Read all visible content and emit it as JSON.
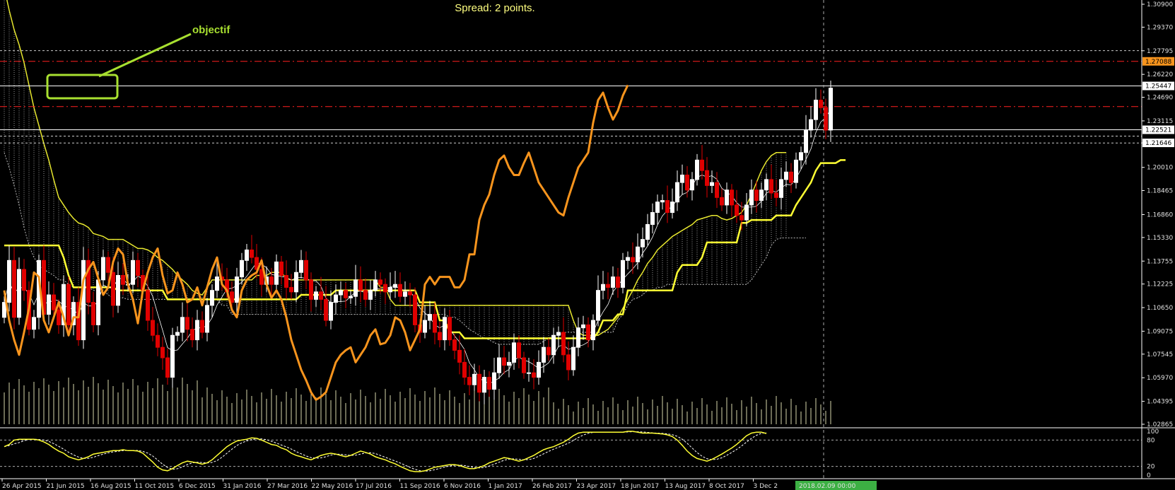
{
  "spread_text": "Spread: 2 points.",
  "annotation_text": "objectif",
  "crosshair_date": "2018.02.09 00:00",
  "colors": {
    "background": "#000000",
    "bull_candle": "#ffffff",
    "bear_candle": "#e00000",
    "kijun": "#ffff33",
    "tenkan": "#ffffff",
    "chikou": "#f7941d",
    "kumo": "#cccccc",
    "volume": "#ffffcc",
    "annotation": "#a8e030",
    "level_line": "#ff2020",
    "price_tag_orange": "#f7941d",
    "oscillator": "#ffff33"
  },
  "chart_data": [
    {
      "type": "candlestick",
      "symbol_hint": "EURUSD weekly with Ichimoku",
      "title": "",
      "y_ticks": [
        "1.30900",
        "1.29370",
        "1.27795",
        "1.26220",
        "1.24690",
        "1.23115",
        "1.21646",
        "1.20010",
        "1.18465",
        "1.16860",
        "1.15330",
        "1.13755",
        "1.12225",
        "1.10650",
        "1.09075",
        "1.07545",
        "1.05970",
        "1.04395",
        "1.02865"
      ],
      "price_tags": [
        {
          "value": "1.27088",
          "style": "orange"
        },
        {
          "value": "1.25447",
          "style": "white"
        },
        {
          "value": "1.22521",
          "style": "white"
        },
        {
          "value": "1.21646",
          "style": "white"
        }
      ],
      "x_labels": [
        "26 Apr 2015",
        "21 Jun 2015",
        "16 Aug 2015",
        "11 Oct 2015",
        "6 Dec 2015",
        "31 Jan 2016",
        "27 Mar 2016",
        "22 May 2016",
        "17 Jul 2016",
        "11 Sep 2016",
        "6 Nov 2016",
        "1 Jan 2017",
        "26 Feb 2017",
        "23 Apr 2017",
        "18 Jun 2017",
        "13 Aug 2017",
        "8 Oct 2017",
        "3 Dec 2"
      ],
      "horizontal_levels": [
        {
          "value": 1.2709,
          "style": "dash-red"
        },
        {
          "value": 1.2407,
          "style": "dash-red"
        },
        {
          "value": 1.2545,
          "style": "solid-white"
        },
        {
          "value": 1.2252,
          "style": "solid-white"
        },
        {
          "value": 1.2164,
          "style": "dot-white"
        },
        {
          "value": 1.278,
          "style": "dot-white"
        },
        {
          "value": 1.221,
          "style": "dot-white"
        }
      ],
      "closes": [
        1.11,
        1.138,
        1.1,
        1.132,
        1.118,
        1.092,
        1.1,
        1.138,
        1.102,
        1.115,
        1.105,
        1.095,
        1.122,
        1.095,
        1.11,
        1.085,
        1.138,
        1.11,
        1.095,
        1.125,
        1.14,
        1.13,
        1.108,
        1.128,
        1.122,
        1.122,
        1.138,
        1.128,
        1.118,
        1.098,
        1.088,
        1.08,
        1.073,
        1.06,
        1.088,
        1.09,
        1.1,
        1.092,
        1.085,
        1.098,
        1.09,
        1.108,
        1.118,
        1.127,
        1.125,
        1.117,
        1.11,
        1.127,
        1.138,
        1.145,
        1.14,
        1.132,
        1.122,
        1.127,
        1.122,
        1.137,
        1.128,
        1.12,
        1.117,
        1.13,
        1.138,
        1.125,
        1.112,
        1.117,
        1.112,
        1.098,
        1.11,
        1.115,
        1.118,
        1.113,
        1.114,
        1.125,
        1.118,
        1.112,
        1.118,
        1.125,
        1.122,
        1.117,
        1.12,
        1.122,
        1.114,
        1.117,
        1.115,
        1.095,
        1.09,
        1.098,
        1.102,
        1.09,
        1.085,
        1.1,
        1.085,
        1.078,
        1.07,
        1.06,
        1.055,
        1.062,
        1.05,
        1.06,
        1.052,
        1.063,
        1.073,
        1.068,
        1.07,
        1.083,
        1.073,
        1.063,
        1.063,
        1.06,
        1.07,
        1.08,
        1.075,
        1.088,
        1.09,
        1.075,
        1.065,
        1.08,
        1.093,
        1.095,
        1.085,
        1.098,
        1.118,
        1.122,
        1.12,
        1.127,
        1.12,
        1.138,
        1.14,
        1.137,
        1.147,
        1.152,
        1.162,
        1.17,
        1.177,
        1.178,
        1.17,
        1.177,
        1.19,
        1.195,
        1.185,
        1.192,
        1.205,
        1.198,
        1.188,
        1.19,
        1.18,
        1.175,
        1.185,
        1.175,
        1.168,
        1.165,
        1.175,
        1.185,
        1.178,
        1.185,
        1.192,
        1.183,
        1.18,
        1.192,
        1.197,
        1.19,
        1.205,
        1.21,
        1.225,
        1.232,
        1.245,
        1.24,
        1.225,
        1.253
      ],
      "series": [
        {
          "name": "kijun",
          "values": [
            1.148,
            1.148,
            1.148,
            1.148,
            1.148,
            1.148,
            1.148,
            1.148,
            1.148,
            1.148,
            1.148,
            1.148,
            1.14,
            1.128,
            1.12,
            1.12,
            1.12,
            1.12,
            1.12,
            1.12,
            1.12,
            1.12,
            1.12,
            1.118,
            1.118,
            1.118,
            1.118,
            1.118,
            1.118,
            1.118,
            1.118,
            1.118,
            1.118,
            1.112,
            1.112,
            1.112,
            1.112,
            1.112,
            1.112,
            1.112,
            1.112,
            1.112,
            1.112,
            1.112,
            1.112,
            1.112,
            1.112,
            1.112,
            1.112,
            1.112,
            1.112,
            1.112,
            1.112,
            1.112,
            1.112,
            1.112,
            1.112,
            1.112,
            1.112,
            1.112,
            1.115,
            1.115,
            1.115,
            1.115,
            1.115,
            1.115,
            1.115,
            1.118,
            1.118,
            1.118,
            1.118,
            1.118,
            1.118,
            1.118,
            1.118,
            1.118,
            1.118,
            1.118,
            1.118,
            1.118,
            1.118,
            1.118,
            1.118,
            1.118,
            1.11,
            1.11,
            1.11,
            1.11,
            1.098,
            1.098,
            1.09,
            1.09,
            1.09,
            1.086,
            1.086,
            1.086,
            1.086,
            1.086,
            1.086,
            1.086,
            1.086,
            1.086,
            1.086,
            1.086,
            1.086,
            1.086,
            1.086,
            1.086,
            1.086,
            1.086,
            1.086,
            1.086,
            1.086,
            1.086,
            1.086,
            1.086,
            1.086,
            1.086,
            1.086,
            1.086,
            1.09,
            1.098,
            1.098,
            1.098,
            1.102,
            1.102,
            1.118,
            1.118,
            1.118,
            1.118,
            1.118,
            1.118,
            1.118,
            1.118,
            1.118,
            1.118,
            1.13,
            1.135,
            1.135,
            1.135,
            1.135,
            1.14,
            1.15,
            1.15,
            1.15,
            1.15,
            1.15,
            1.15,
            1.15,
            1.163,
            1.163,
            1.165,
            1.165,
            1.165,
            1.165,
            1.165,
            1.168,
            1.168,
            1.168,
            1.168,
            1.175,
            1.18,
            1.185,
            1.19,
            1.198,
            1.203,
            1.203,
            1.203,
            1.203,
            1.205,
            1.205
          ]
        },
        {
          "name": "chikou",
          "values": [
            1.118,
            1.098,
            1.085,
            1.075,
            1.09,
            1.106,
            1.13,
            1.127,
            1.098,
            1.09,
            1.1,
            1.11,
            1.1,
            1.088,
            1.1,
            1.1,
            1.125,
            1.132,
            1.137,
            1.126,
            1.115,
            1.12,
            1.137,
            1.146,
            1.142,
            1.122,
            1.112,
            1.096,
            1.118,
            1.13,
            1.14,
            1.146,
            1.128,
            1.116,
            1.118,
            1.13,
            1.122,
            1.11,
            1.112,
            1.12,
            1.108,
            1.12,
            1.132,
            1.14,
            1.122,
            1.118,
            1.105,
            1.1,
            1.118,
            1.125,
            1.128,
            1.13,
            1.138,
            1.122,
            1.113,
            1.118,
            1.112,
            1.1,
            1.085,
            1.075,
            1.065,
            1.058,
            1.05,
            1.045,
            1.047,
            1.05,
            1.06,
            1.07,
            1.075,
            1.078,
            1.08,
            1.07,
            1.075,
            1.08,
            1.088,
            1.092,
            1.082,
            1.083,
            1.088,
            1.1,
            1.098,
            1.09,
            1.078,
            1.085,
            1.092,
            1.122,
            1.127,
            1.122,
            1.127,
            1.127,
            1.127,
            1.12,
            1.12,
            1.125,
            1.142,
            1.142,
            1.165,
            1.175,
            1.182,
            1.195,
            1.205,
            1.208,
            1.2,
            1.195,
            1.195,
            1.203,
            1.21,
            1.2,
            1.19,
            1.185,
            1.18,
            1.175,
            1.17,
            1.168,
            1.18,
            1.19,
            1.2,
            1.205,
            1.21,
            1.23,
            1.245,
            1.25,
            1.24,
            1.232,
            1.238,
            1.248,
            1.255
          ]
        },
        {
          "name": "kumo_upper",
          "values": [
            1.32,
            1.305,
            1.292,
            1.282,
            1.27,
            1.255,
            1.24,
            1.228,
            1.216,
            1.205,
            1.192,
            1.18,
            1.175,
            1.17,
            1.166,
            1.163,
            1.162,
            1.16,
            1.156,
            1.155,
            1.154,
            1.152,
            1.152,
            1.152,
            1.152,
            1.15,
            1.148,
            1.146,
            1.146,
            1.145,
            1.143,
            1.14,
            1.138,
            1.135,
            1.132,
            1.128,
            1.125,
            1.122,
            1.118,
            1.116,
            1.115,
            1.12,
            1.125,
            1.125,
            1.125,
            1.125,
            1.125,
            1.125,
            1.125,
            1.125,
            1.125,
            1.128,
            1.128,
            1.128,
            1.13,
            1.13,
            1.13,
            1.126,
            1.125,
            1.125,
            1.125,
            1.125,
            1.125,
            1.125,
            1.125,
            1.125,
            1.125,
            1.125,
            1.125,
            1.125,
            1.125,
            1.125,
            1.125,
            1.125,
            1.125,
            1.125,
            1.12,
            1.12,
            1.112,
            1.108,
            1.108,
            1.108,
            1.108,
            1.108,
            1.108,
            1.108,
            1.108,
            1.108,
            1.108,
            1.108,
            1.108,
            1.108,
            1.108,
            1.108,
            1.108,
            1.108,
            1.108,
            1.108,
            1.108,
            1.108,
            1.108,
            1.108,
            1.108,
            1.108,
            1.108,
            1.108,
            1.108,
            1.108,
            1.108,
            1.108,
            1.108,
            1.108,
            1.108,
            1.108,
            1.108,
            1.098,
            1.09,
            1.088,
            1.088,
            1.088,
            1.088,
            1.09,
            1.092,
            1.096,
            1.1,
            1.106,
            1.112,
            1.118,
            1.125,
            1.13,
            1.136,
            1.14,
            1.145,
            1.148,
            1.151,
            1.154,
            1.156,
            1.158,
            1.16,
            1.162,
            1.165,
            1.166,
            1.167,
            1.168,
            1.168,
            1.166,
            1.165,
            1.166,
            1.168,
            1.17,
            1.175,
            1.182,
            1.19,
            1.198,
            1.204,
            1.208,
            1.21,
            1.21,
            1.21
          ]
        },
        {
          "name": "kumo_lower",
          "values": [
            1.21,
            1.2,
            1.188,
            1.175,
            1.16,
            1.148,
            1.14,
            1.135,
            1.132,
            1.13,
            1.128,
            1.125,
            1.125,
            1.122,
            1.12,
            1.12,
            1.12,
            1.12,
            1.118,
            1.118,
            1.118,
            1.115,
            1.113,
            1.113,
            1.113,
            1.112,
            1.112,
            1.112,
            1.112,
            1.112,
            1.112,
            1.112,
            1.112,
            1.112,
            1.112,
            1.112,
            1.112,
            1.112,
            1.112,
            1.112,
            1.112,
            1.112,
            1.112,
            1.112,
            1.108,
            1.108,
            1.102,
            1.102,
            1.102,
            1.102,
            1.102,
            1.102,
            1.102,
            1.102,
            1.102,
            1.102,
            1.102,
            1.102,
            1.102,
            1.102,
            1.102,
            1.102,
            1.102,
            1.102,
            1.102,
            1.102,
            1.102,
            1.102,
            1.102,
            1.102,
            1.102,
            1.102,
            1.102,
            1.102,
            1.102,
            1.102,
            1.102,
            1.102,
            1.102,
            1.102,
            1.102,
            1.102,
            1.102,
            1.102,
            1.102,
            1.102,
            1.102,
            1.102,
            1.102,
            1.102,
            1.1,
            1.1,
            1.098,
            1.095,
            1.092,
            1.09,
            1.088,
            1.086,
            1.085,
            1.083,
            1.082,
            1.082,
            1.082,
            1.082,
            1.082,
            1.082,
            1.082,
            1.082,
            1.082,
            1.084,
            1.086,
            1.088,
            1.088,
            1.09,
            1.09,
            1.09,
            1.09,
            1.09,
            1.09,
            1.09,
            1.09,
            1.09,
            1.09,
            1.09,
            1.098,
            1.102,
            1.108,
            1.112,
            1.113,
            1.115,
            1.118,
            1.118,
            1.12,
            1.12,
            1.122,
            1.122,
            1.122,
            1.122,
            1.122,
            1.122,
            1.122,
            1.122,
            1.122,
            1.122,
            1.122,
            1.122,
            1.122,
            1.122,
            1.122,
            1.122,
            1.122,
            1.125,
            1.13,
            1.135,
            1.14,
            1.148,
            1.152,
            1.153,
            1.153,
            1.153,
            1.153,
            1.153,
            1.153
          ]
        }
      ]
    },
    {
      "type": "line",
      "title": "",
      "y_ticks": [
        "100",
        "80",
        "20",
        "0"
      ],
      "levels": [
        80,
        20
      ],
      "series": [
        {
          "name": "main",
          "values": [
            65,
            70,
            80,
            82,
            82,
            82,
            82,
            80,
            76,
            70,
            62,
            55,
            50,
            42,
            38,
            35,
            38,
            42,
            48,
            50,
            52,
            54,
            56,
            56,
            58,
            56,
            56,
            55,
            50,
            40,
            30,
            18,
            12,
            10,
            15,
            22,
            28,
            32,
            30,
            28,
            25,
            28,
            35,
            45,
            55,
            65,
            72,
            78,
            80,
            82,
            85,
            84,
            80,
            75,
            70,
            68,
            62,
            58,
            50,
            45,
            42,
            38,
            35,
            40,
            45,
            48,
            50,
            48,
            45,
            42,
            45,
            50,
            55,
            52,
            48,
            42,
            38,
            35,
            30,
            26,
            20,
            15,
            10,
            8,
            8,
            10,
            14,
            18,
            20,
            22,
            24,
            24,
            22,
            18,
            15,
            15,
            18,
            22,
            28,
            32,
            36,
            40,
            38,
            35,
            32,
            35,
            40,
            45,
            52,
            58,
            62,
            65,
            70,
            75,
            82,
            90,
            96,
            98,
            98,
            98,
            98,
            98,
            98,
            98,
            98,
            98,
            100,
            100,
            98,
            96,
            96,
            96,
            95,
            94,
            92,
            88,
            80,
            68,
            55,
            45,
            38,
            35,
            32,
            36,
            42,
            48,
            55,
            62,
            70,
            80,
            90,
            96,
            98,
            98,
            95
          ]
        }
      ]
    }
  ]
}
